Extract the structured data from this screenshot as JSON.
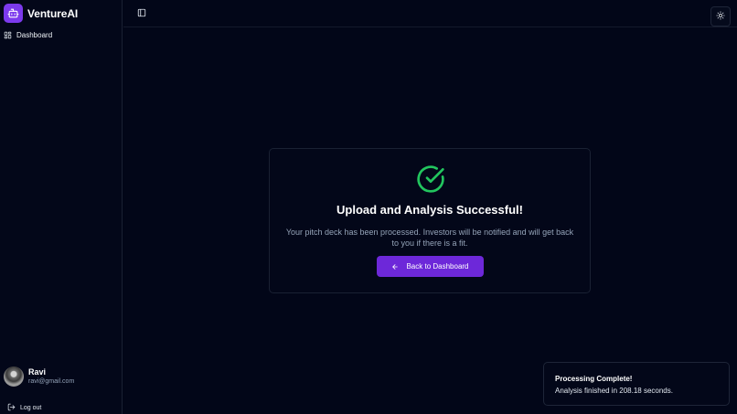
{
  "app": {
    "name": "VentureAI"
  },
  "sidebar": {
    "items": [
      {
        "label": "Dashboard",
        "icon": "grid-icon"
      }
    ],
    "user": {
      "name": "Ravi",
      "email": "ravi@gmail.com"
    },
    "logout_label": "Log out"
  },
  "card": {
    "title": "Upload and Analysis Successful!",
    "message": "Your pitch deck has been processed. Investors will be notified and will get back to you if there is a fit.",
    "button_label": "Back to Dashboard"
  },
  "toast": {
    "title": "Processing Complete!",
    "message": "Analysis finished in 208.18 seconds."
  },
  "colors": {
    "background": "#020618",
    "accent": "#6d28d9",
    "brand": "#7c3aed",
    "success": "#22c55e"
  }
}
